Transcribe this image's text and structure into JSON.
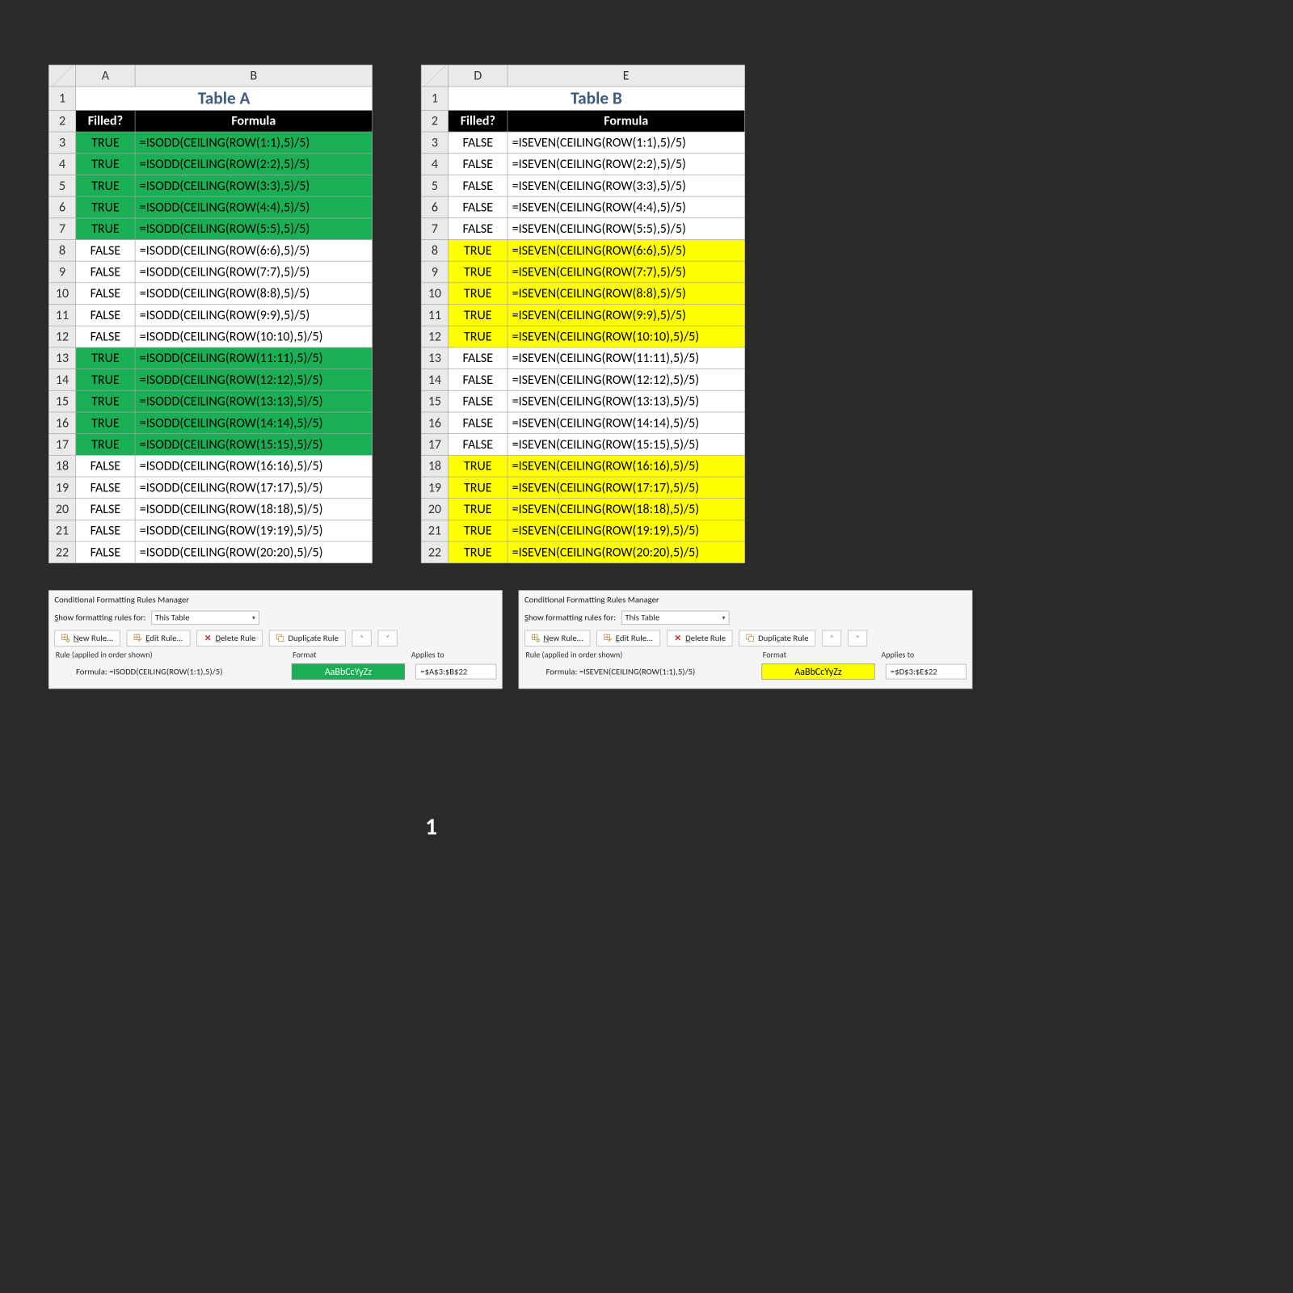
{
  "page_number": "1",
  "tables": [
    {
      "cols": [
        "A",
        "B"
      ],
      "title": "Table A",
      "headers": [
        "Filled?",
        "Formula"
      ],
      "fill_color": "green",
      "rows": [
        {
          "n": "3",
          "filled": "TRUE",
          "formula": "=ISODD(CEILING(ROW(1:1),5)/5)",
          "hl": true
        },
        {
          "n": "4",
          "filled": "TRUE",
          "formula": "=ISODD(CEILING(ROW(2:2),5)/5)",
          "hl": true
        },
        {
          "n": "5",
          "filled": "TRUE",
          "formula": "=ISODD(CEILING(ROW(3:3),5)/5)",
          "hl": true
        },
        {
          "n": "6",
          "filled": "TRUE",
          "formula": "=ISODD(CEILING(ROW(4:4),5)/5)",
          "hl": true
        },
        {
          "n": "7",
          "filled": "TRUE",
          "formula": "=ISODD(CEILING(ROW(5:5),5)/5)",
          "hl": true
        },
        {
          "n": "8",
          "filled": "FALSE",
          "formula": "=ISODD(CEILING(ROW(6:6),5)/5)",
          "hl": false
        },
        {
          "n": "9",
          "filled": "FALSE",
          "formula": "=ISODD(CEILING(ROW(7:7),5)/5)",
          "hl": false
        },
        {
          "n": "10",
          "filled": "FALSE",
          "formula": "=ISODD(CEILING(ROW(8:8),5)/5)",
          "hl": false
        },
        {
          "n": "11",
          "filled": "FALSE",
          "formula": "=ISODD(CEILING(ROW(9:9),5)/5)",
          "hl": false
        },
        {
          "n": "12",
          "filled": "FALSE",
          "formula": "=ISODD(CEILING(ROW(10:10),5)/5)",
          "hl": false
        },
        {
          "n": "13",
          "filled": "TRUE",
          "formula": "=ISODD(CEILING(ROW(11:11),5)/5)",
          "hl": true
        },
        {
          "n": "14",
          "filled": "TRUE",
          "formula": "=ISODD(CEILING(ROW(12:12),5)/5)",
          "hl": true
        },
        {
          "n": "15",
          "filled": "TRUE",
          "formula": "=ISODD(CEILING(ROW(13:13),5)/5)",
          "hl": true
        },
        {
          "n": "16",
          "filled": "TRUE",
          "formula": "=ISODD(CEILING(ROW(14:14),5)/5)",
          "hl": true
        },
        {
          "n": "17",
          "filled": "TRUE",
          "formula": "=ISODD(CEILING(ROW(15:15),5)/5)",
          "hl": true
        },
        {
          "n": "18",
          "filled": "FALSE",
          "formula": "=ISODD(CEILING(ROW(16:16),5)/5)",
          "hl": false
        },
        {
          "n": "19",
          "filled": "FALSE",
          "formula": "=ISODD(CEILING(ROW(17:17),5)/5)",
          "hl": false
        },
        {
          "n": "20",
          "filled": "FALSE",
          "formula": "=ISODD(CEILING(ROW(18:18),5)/5)",
          "hl": false
        },
        {
          "n": "21",
          "filled": "FALSE",
          "formula": "=ISODD(CEILING(ROW(19:19),5)/5)",
          "hl": false
        },
        {
          "n": "22",
          "filled": "FALSE",
          "formula": "=ISODD(CEILING(ROW(20:20),5)/5)",
          "hl": false
        }
      ]
    },
    {
      "cols": [
        "D",
        "E"
      ],
      "title": "Table B",
      "headers": [
        "Filled?",
        "Formula"
      ],
      "fill_color": "yellow",
      "rows": [
        {
          "n": "3",
          "filled": "FALSE",
          "formula": "=ISEVEN(CEILING(ROW(1:1),5)/5)",
          "hl": false
        },
        {
          "n": "4",
          "filled": "FALSE",
          "formula": "=ISEVEN(CEILING(ROW(2:2),5)/5)",
          "hl": false
        },
        {
          "n": "5",
          "filled": "FALSE",
          "formula": "=ISEVEN(CEILING(ROW(3:3),5)/5)",
          "hl": false
        },
        {
          "n": "6",
          "filled": "FALSE",
          "formula": "=ISEVEN(CEILING(ROW(4:4),5)/5)",
          "hl": false
        },
        {
          "n": "7",
          "filled": "FALSE",
          "formula": "=ISEVEN(CEILING(ROW(5:5),5)/5)",
          "hl": false
        },
        {
          "n": "8",
          "filled": "TRUE",
          "formula": "=ISEVEN(CEILING(ROW(6:6),5)/5)",
          "hl": true
        },
        {
          "n": "9",
          "filled": "TRUE",
          "formula": "=ISEVEN(CEILING(ROW(7:7),5)/5)",
          "hl": true
        },
        {
          "n": "10",
          "filled": "TRUE",
          "formula": "=ISEVEN(CEILING(ROW(8:8),5)/5)",
          "hl": true
        },
        {
          "n": "11",
          "filled": "TRUE",
          "formula": "=ISEVEN(CEILING(ROW(9:9),5)/5)",
          "hl": true
        },
        {
          "n": "12",
          "filled": "TRUE",
          "formula": "=ISEVEN(CEILING(ROW(10:10),5)/5)",
          "hl": true
        },
        {
          "n": "13",
          "filled": "FALSE",
          "formula": "=ISEVEN(CEILING(ROW(11:11),5)/5)",
          "hl": false
        },
        {
          "n": "14",
          "filled": "FALSE",
          "formula": "=ISEVEN(CEILING(ROW(12:12),5)/5)",
          "hl": false
        },
        {
          "n": "15",
          "filled": "FALSE",
          "formula": "=ISEVEN(CEILING(ROW(13:13),5)/5)",
          "hl": false
        },
        {
          "n": "16",
          "filled": "FALSE",
          "formula": "=ISEVEN(CEILING(ROW(14:14),5)/5)",
          "hl": false
        },
        {
          "n": "17",
          "filled": "FALSE",
          "formula": "=ISEVEN(CEILING(ROW(15:15),5)/5)",
          "hl": false
        },
        {
          "n": "18",
          "filled": "TRUE",
          "formula": "=ISEVEN(CEILING(ROW(16:16),5)/5)",
          "hl": true
        },
        {
          "n": "19",
          "filled": "TRUE",
          "formula": "=ISEVEN(CEILING(ROW(17:17),5)/5)",
          "hl": true
        },
        {
          "n": "20",
          "filled": "TRUE",
          "formula": "=ISEVEN(CEILING(ROW(18:18),5)/5)",
          "hl": true
        },
        {
          "n": "21",
          "filled": "TRUE",
          "formula": "=ISEVEN(CEILING(ROW(19:19),5)/5)",
          "hl": true
        },
        {
          "n": "22",
          "filled": "TRUE",
          "formula": "=ISEVEN(CEILING(ROW(20:20),5)/5)",
          "hl": true
        }
      ]
    }
  ],
  "manager": {
    "title": "Conditional Formatting Rules Manager",
    "show_label_pre": "S",
    "show_label_post": "how formatting rules for:",
    "scope": "This Table",
    "buttons": {
      "new": "New Rule...",
      "edit": "Edit Rule...",
      "delete": "Delete Rule",
      "duplicate": "Duplicate Rule"
    },
    "cols": {
      "rule": "Rule (applied in order shown)",
      "format": "Format",
      "applies": "Applies to"
    },
    "preview_text": "AaBbCcYyZz",
    "panels": [
      {
        "formula": "Formula: =ISODD(CEILING(ROW(1:1),5)/5)",
        "preview_class": "fmt-green",
        "range": "=$A$3:$B$22"
      },
      {
        "formula": "Formula: =ISEVEN(CEILING(ROW(1:1),5)/5)",
        "preview_class": "fmt-yellow",
        "range": "=$D$3:$E$22"
      }
    ]
  }
}
